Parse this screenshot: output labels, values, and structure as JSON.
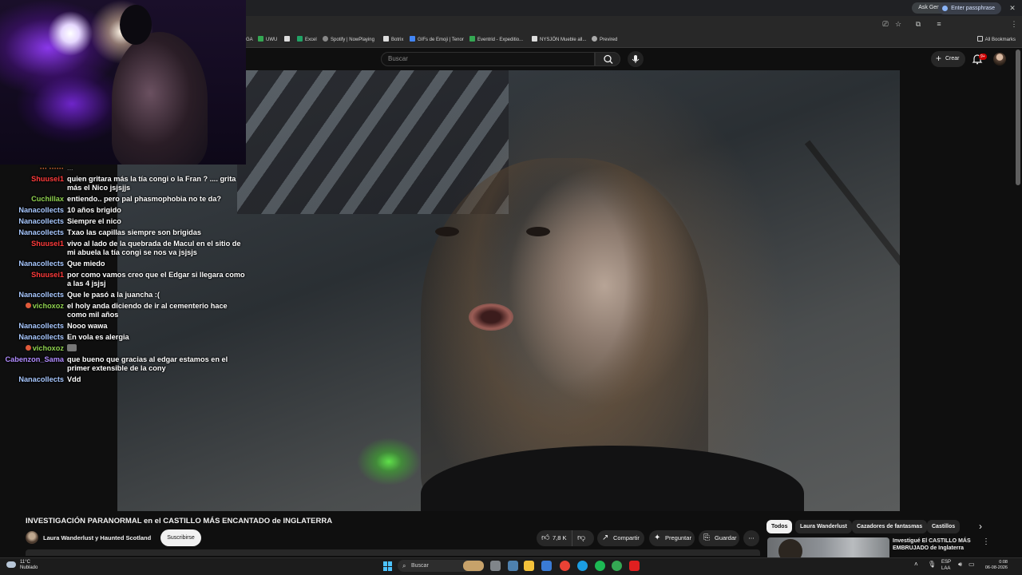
{
  "browser": {
    "gemini_label": "Ask Gemini",
    "passphrase_label": "Enter passphrase",
    "bookmarks": [
      {
        "label": "GA",
        "color": "#34a853"
      },
      {
        "label": "UWU",
        "color": "#34a853"
      },
      {
        "label": "",
        "color": "#dddddd"
      },
      {
        "label": "Excel",
        "color": "#21a366"
      },
      {
        "label": "Spotify | NowPlaying",
        "color": "#888888"
      },
      {
        "label": "Botrix",
        "color": "#dddddd"
      },
      {
        "label": "GIFs de Emoji | Tenor",
        "color": "#4285f4"
      },
      {
        "label": "Eventrid - Expeditio...",
        "color": "#34a853"
      },
      {
        "label": "NYSJÖN Mueble all...",
        "color": "#dddddd"
      },
      {
        "label": "Previred",
        "color": "#aaaaaa"
      }
    ],
    "all_bookmarks": "All Bookmarks"
  },
  "youtube": {
    "search_placeholder": "Buscar",
    "create_label": "Crear",
    "notif_count": "9+",
    "video_title": "INVESTIGACIÓN PARANORMAL en el CASTILLO MÁS ENCANTADO de INGLATERRA",
    "channel_name": "Laura Wanderlust y Haunted Scotland",
    "subscribe_label": "Suscribirse",
    "like_count": "7,8 K",
    "share_label": "Compartir",
    "ask_label": "Preguntar",
    "save_label": "Guardar",
    "chips": [
      "Todos",
      "Laura Wanderlust",
      "Cazadores de fantasmas",
      "Castillos"
    ],
    "recommended_title": "Investigué El CASTILLO MÁS EMBRUJADO de Inglaterra"
  },
  "chat": {
    "partial_top": "...",
    "messages": [
      {
        "user": "Shuusei1",
        "color": "#ff3b3b",
        "badge": false,
        "text": "quien gritara más la tía congi o la Fran ? .... grita más el Nico jsjsjjs"
      },
      {
        "user": "Cuchillax",
        "color": "#8fd14f",
        "badge": false,
        "text": "entiendo.. pero pal phasmophobia no te da?"
      },
      {
        "user": "Nanacollects",
        "color": "#a8c8ff",
        "badge": false,
        "text": "10 años brigido"
      },
      {
        "user": "Nanacollects",
        "color": "#a8c8ff",
        "badge": false,
        "text": "Siempre el nico"
      },
      {
        "user": "Nanacollects",
        "color": "#a8c8ff",
        "badge": false,
        "text": "Txao las capillas siempre son brigidas"
      },
      {
        "user": "Shuusei1",
        "color": "#ff3b3b",
        "badge": false,
        "text": "vivo al lado de la quebrada de Macul en el sitio de mi abuela la tía congi se nos va jsjsjs"
      },
      {
        "user": "Nanacollects",
        "color": "#a8c8ff",
        "badge": false,
        "text": "Que miedo"
      },
      {
        "user": "Shuusei1",
        "color": "#ff3b3b",
        "badge": false,
        "text": "por como vamos creo que el Edgar si llegara como a las 4 jsjsj"
      },
      {
        "user": "Nanacollects",
        "color": "#a8c8ff",
        "badge": false,
        "text": "Que le pasó a la juancha :("
      },
      {
        "user": "vichoxoz",
        "color": "#8fd14f",
        "badge": true,
        "text": "el holy anda diciendo de ir al cementerio hace como mil años"
      },
      {
        "user": "Nanacollects",
        "color": "#a8c8ff",
        "badge": false,
        "text": "Nooo wawa"
      },
      {
        "user": "Nanacollects",
        "color": "#a8c8ff",
        "badge": false,
        "text": "En vola es alergia"
      },
      {
        "user": "vichoxoz",
        "color": "#8fd14f",
        "badge": true,
        "text": "",
        "emote": true
      },
      {
        "user": "Cabenzon_Sama",
        "color": "#b18cff",
        "badge": false,
        "text": "que bueno que gracias al edgar estamos en el primer extensible de la cony"
      },
      {
        "user": "Nanacollects",
        "color": "#a8c8ff",
        "badge": false,
        "text": "Vdd"
      }
    ]
  },
  "taskbar": {
    "temperature": "11°C",
    "weather": "Nublado",
    "search_label": "Buscar",
    "lang_top": "ESP",
    "lang_bottom": "LAA",
    "time": "0:08",
    "date": "06-08-2026",
    "apps": [
      {
        "name": "file-explorer-icon",
        "color": "#f3c13a"
      },
      {
        "name": "store-icon",
        "color": "#3a7bd5"
      },
      {
        "name": "chrome-icon",
        "color": "#e94235"
      },
      {
        "name": "edge-icon",
        "color": "#1b9de2"
      },
      {
        "name": "spotify-icon",
        "color": "#1db954"
      },
      {
        "name": "chrome-alt-icon",
        "color": "#34a853"
      },
      {
        "name": "app-red-icon",
        "color": "#e02020"
      }
    ]
  }
}
